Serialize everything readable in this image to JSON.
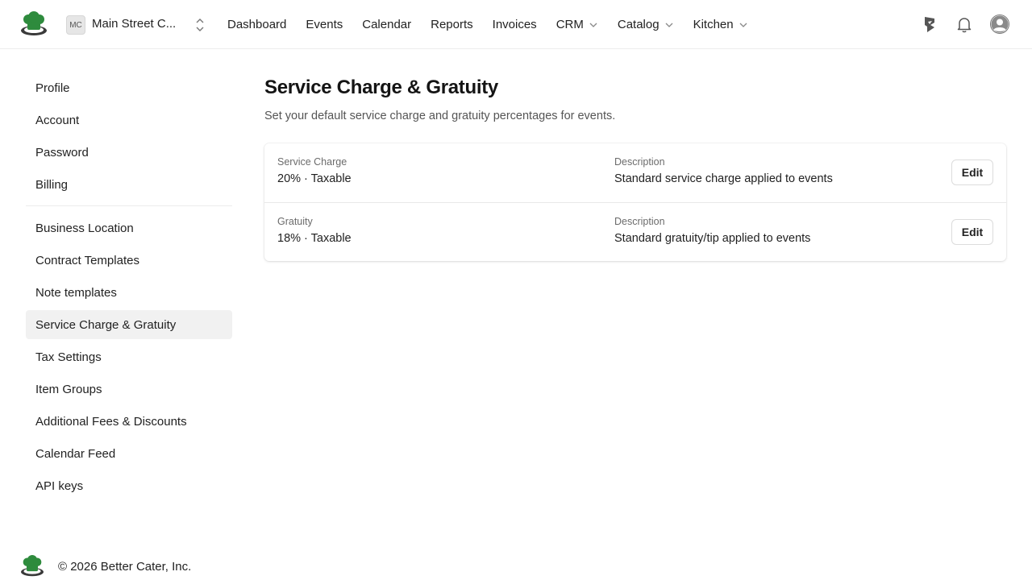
{
  "header": {
    "logo_icon": "chef-hat-logo-icon",
    "org_initials": "MC",
    "org_name": "Main Street C...",
    "nav": [
      {
        "label": "Dashboard",
        "has_menu": false
      },
      {
        "label": "Events",
        "has_menu": false
      },
      {
        "label": "Calendar",
        "has_menu": false
      },
      {
        "label": "Reports",
        "has_menu": false
      },
      {
        "label": "Invoices",
        "has_menu": false
      },
      {
        "label": "CRM",
        "has_menu": true
      },
      {
        "label": "Catalog",
        "has_menu": true
      },
      {
        "label": "Kitchen",
        "has_menu": true
      }
    ],
    "icons": [
      "whats-new-icon",
      "bell-icon",
      "user-avatar-icon"
    ]
  },
  "sidebar": {
    "group1": [
      "Profile",
      "Account",
      "Password",
      "Billing"
    ],
    "group2": [
      "Business Location",
      "Contract Templates",
      "Note templates",
      "Service Charge & Gratuity",
      "Tax Settings",
      "Item Groups",
      "Additional Fees & Discounts",
      "Calendar Feed",
      "API keys"
    ],
    "active": "Service Charge & Gratuity"
  },
  "main": {
    "title": "Service Charge & Gratuity",
    "subtitle": "Set your default service charge and gratuity percentages for events.",
    "rows": [
      {
        "name_label": "Service Charge",
        "value": "20% · Taxable",
        "desc_label": "Description",
        "desc": "Standard service charge applied to events",
        "button": "Edit"
      },
      {
        "name_label": "Gratuity",
        "value": "18% · Taxable",
        "desc_label": "Description",
        "desc": "Standard gratuity/tip applied to events",
        "button": "Edit"
      }
    ]
  },
  "footer": {
    "text": "© 2026 Better Cater, Inc."
  },
  "colors": {
    "brand_green": "#2e8b3d",
    "active_bg": "#f1f1f1",
    "border": "#ececec"
  }
}
